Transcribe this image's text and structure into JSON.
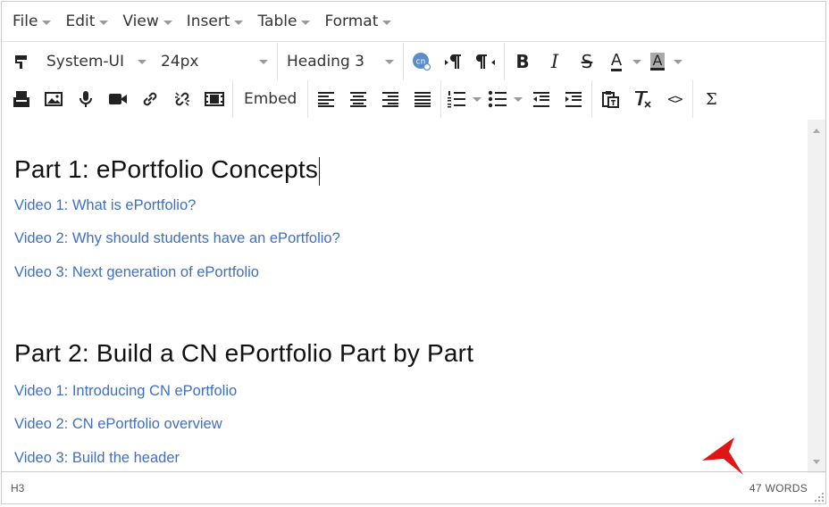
{
  "menubar": [
    {
      "label": "File"
    },
    {
      "label": "Edit"
    },
    {
      "label": "View"
    },
    {
      "label": "Insert"
    },
    {
      "label": "Table"
    },
    {
      "label": "Format"
    }
  ],
  "toolbar": {
    "font_family": "System-UI",
    "font_size": "24px",
    "block_format": "Heading 3",
    "embed_label": "Embed",
    "icons_row1": [
      "format-painter-icon",
      "cn-plugin-icon",
      "ltr-paragraph-icon",
      "rtl-paragraph-icon",
      "bold-icon",
      "italic-icon",
      "strikethrough-icon",
      "text-color-icon",
      "background-color-icon"
    ],
    "icons_row2": [
      "save-draft-icon",
      "image-icon",
      "microphone-icon",
      "video-icon",
      "link-icon",
      "unlink-icon",
      "media-icon",
      "align-left-icon",
      "align-center-icon",
      "align-right-icon",
      "justify-icon",
      "numbered-list-icon",
      "bullet-list-icon",
      "outdent-icon",
      "indent-icon",
      "paste-text-icon",
      "clear-formatting-icon",
      "source-code-icon",
      "sigma-icon"
    ],
    "bold_glyph": "B",
    "italic_glyph": "I",
    "strike_glyph": "S",
    "textcolor_glyph": "A",
    "bgcolor_glyph": "A",
    "sigma_glyph": "Σ",
    "code_glyph": "<>",
    "cn_glyph": "cn"
  },
  "content": {
    "heading1": "Part 1: ePortfolio Concepts",
    "section1_links": [
      "Video 1: What is ePortfolio?",
      "Video 2: Why should students have an ePortfolio?",
      "Video 3: Next generation of ePortfolio"
    ],
    "heading2": "Part 2: Build a CN ePortfolio Part by Part",
    "section2_links": [
      "Video 1: Introducing CN ePortfolio",
      "Video 2: CN ePortfolio overview",
      "Video 3: Build the header"
    ]
  },
  "statusbar": {
    "path": "H3",
    "word_count": "47 WORDS"
  },
  "colors": {
    "link": "#3f6fc2",
    "annotation_arrow": "#e01616"
  }
}
